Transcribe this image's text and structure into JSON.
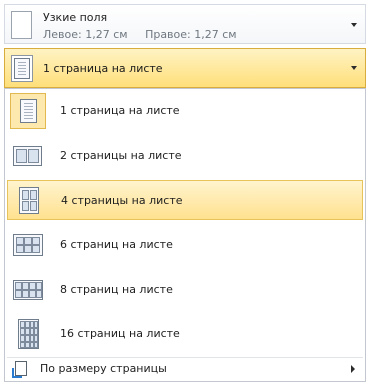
{
  "margins": {
    "title": "Узкие поля",
    "left": "Левое:  1,27 см",
    "right": "Правое:  1,27 см"
  },
  "selected": {
    "label": "1 страница на листе"
  },
  "menu": {
    "items": [
      {
        "label": "1 страница на листе",
        "icon": "one-page-icon",
        "checked": true
      },
      {
        "label": "2 страницы на листе",
        "icon": "two-pages-icon"
      },
      {
        "label": "4 страницы на листе",
        "icon": "four-pages-icon",
        "hover": true
      },
      {
        "label": "6 страниц на листе",
        "icon": "six-pages-icon"
      },
      {
        "label": "8 страниц на листе",
        "icon": "eight-pages-icon"
      },
      {
        "label": "16 страниц на листе",
        "icon": "sixteen-pages-icon"
      }
    ],
    "footer": {
      "label": "По размеру страницы",
      "icon": "scale-to-paper-icon"
    }
  },
  "colors": {
    "highlight": "#ffdf7a",
    "highlight_border": "#d9ad3d",
    "menu_border": "#c3c8d0"
  }
}
